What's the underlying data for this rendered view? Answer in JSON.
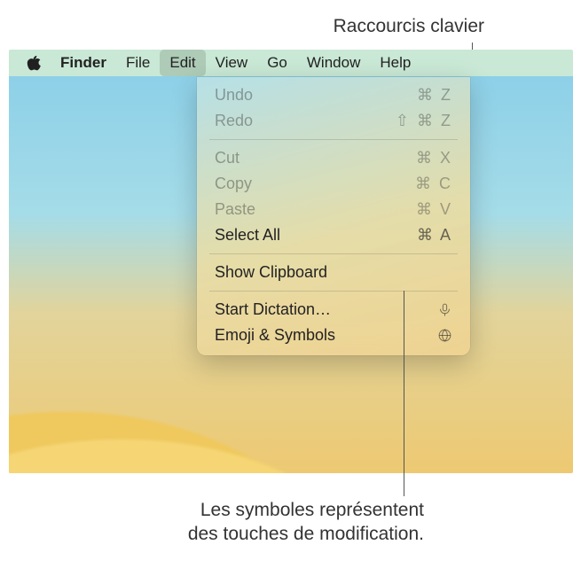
{
  "callouts": {
    "top": "Raccourcis clavier",
    "bottom_line1": "Les symboles représentent",
    "bottom_line2": "des touches de modification."
  },
  "menubar": {
    "app": "Finder",
    "items": [
      "File",
      "Edit",
      "View",
      "Go",
      "Window",
      "Help"
    ],
    "active_index": 1
  },
  "dropdown": {
    "groups": [
      [
        {
          "label": "Undo",
          "shortcut": "⌘ Z",
          "enabled": false
        },
        {
          "label": "Redo",
          "shortcut": "⇧ ⌘ Z",
          "enabled": false
        }
      ],
      [
        {
          "label": "Cut",
          "shortcut": "⌘ X",
          "enabled": false
        },
        {
          "label": "Copy",
          "shortcut": "⌘ C",
          "enabled": false
        },
        {
          "label": "Paste",
          "shortcut": "⌘ V",
          "enabled": false
        },
        {
          "label": "Select All",
          "shortcut": "⌘ A",
          "enabled": true
        }
      ],
      [
        {
          "label": "Show Clipboard",
          "shortcut": "",
          "enabled": true
        }
      ],
      [
        {
          "label": "Start Dictation…",
          "shortcut": "",
          "enabled": true,
          "icon": "mic"
        },
        {
          "label": "Emoji & Symbols",
          "shortcut": "",
          "enabled": true,
          "icon": "globe"
        }
      ]
    ]
  }
}
